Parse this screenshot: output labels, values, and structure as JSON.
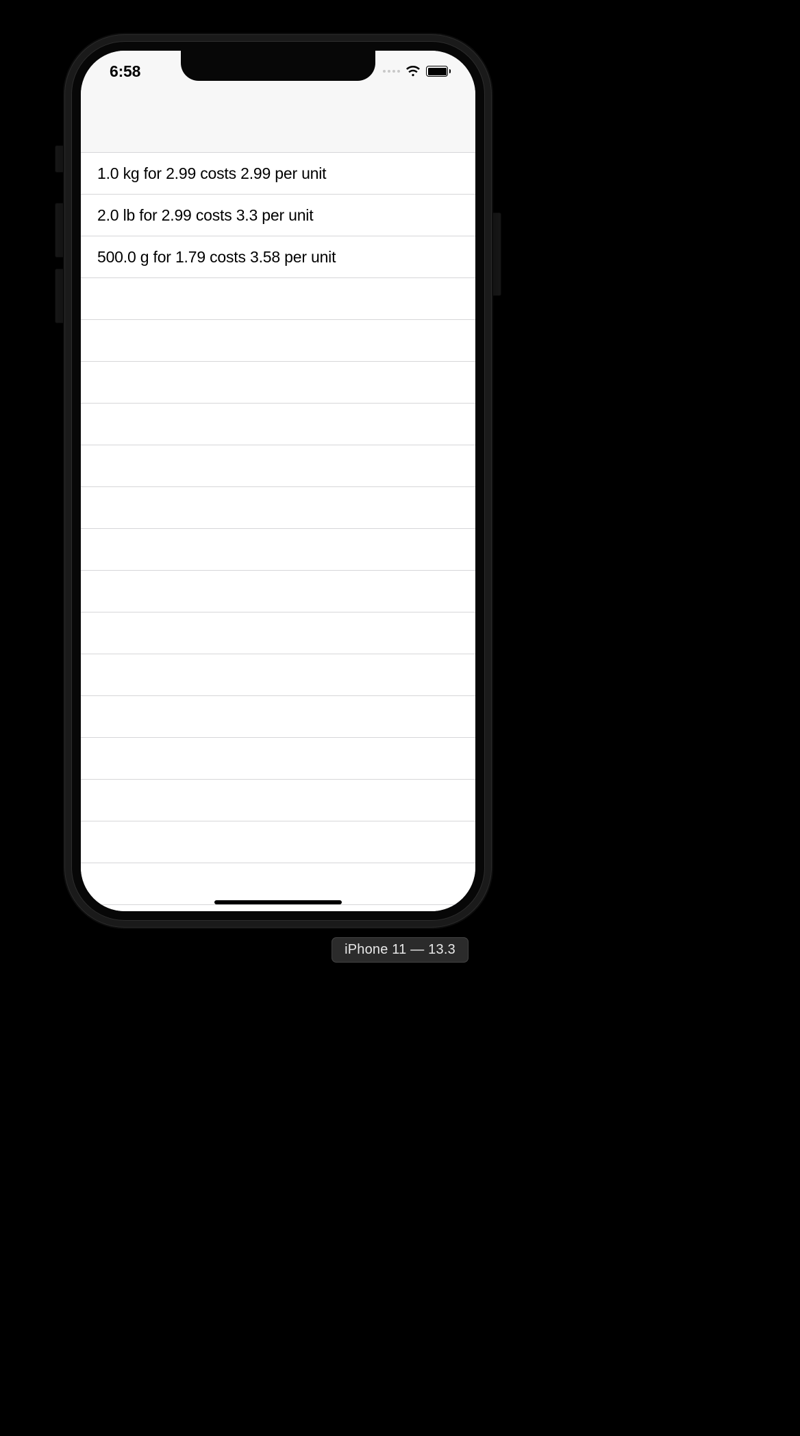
{
  "status_bar": {
    "time": "6:58"
  },
  "list": {
    "rows": [
      {
        "text": "1.0 kg for 2.99 costs 2.99 per unit"
      },
      {
        "text": "2.0 lb for 2.99 costs 3.3 per unit"
      },
      {
        "text": "500.0 g for 1.79 costs 3.58 per unit"
      }
    ],
    "empty_row_placeholder": ""
  },
  "simulator": {
    "caption": "iPhone 11 — 13.3"
  },
  "colors": {
    "background": "#000000",
    "screen": "#ffffff",
    "header": "#f7f7f7",
    "separator": "#d6d6d8",
    "text": "#000000"
  }
}
